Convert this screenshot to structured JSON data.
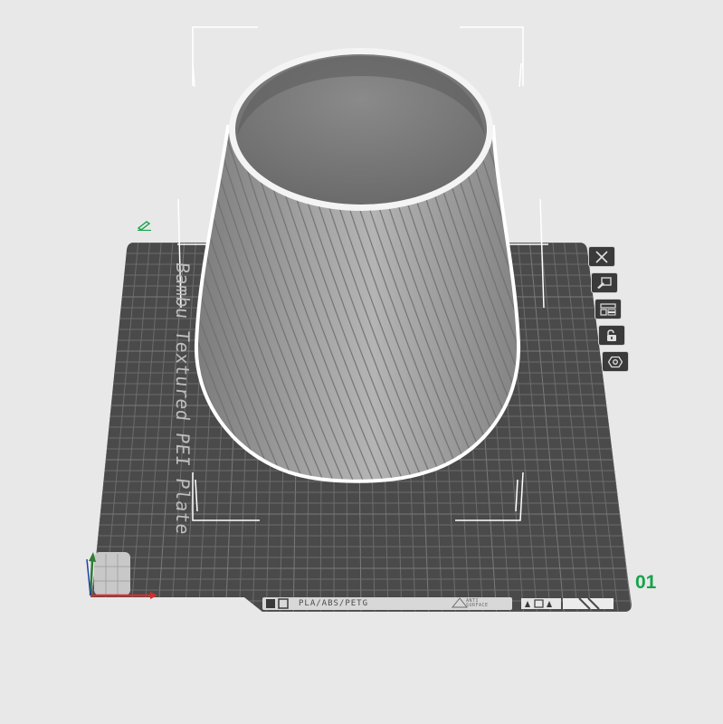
{
  "plate": {
    "name": "Bambu Textured PEI Plate",
    "number": "01",
    "filament_label": "PLA/ABS/PETG",
    "surface_label": "ANTI SURFACE"
  },
  "plate_tools": [
    {
      "id": "close",
      "icon": "close-icon"
    },
    {
      "id": "auto-orient",
      "icon": "orient-icon"
    },
    {
      "id": "arrange",
      "icon": "arrange-icon"
    },
    {
      "id": "lock",
      "icon": "unlock-icon"
    },
    {
      "id": "settings",
      "icon": "hex-settings-icon"
    }
  ],
  "colors": {
    "background": "#e8e8e8",
    "plate": "#4a4a4a",
    "grid": "#6a6a6a",
    "model": "#9a9a9a",
    "accent_green": "#16a34a",
    "axis_x": "#d32f2f",
    "axis_y": "#2e7d32",
    "axis_z": "#1e40af"
  }
}
